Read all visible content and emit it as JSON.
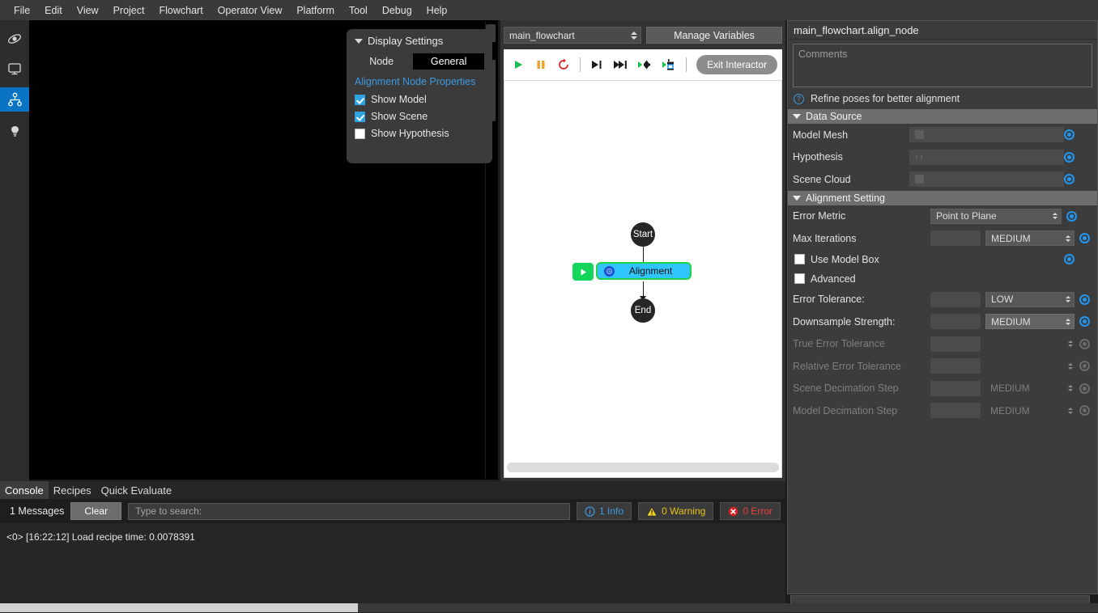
{
  "menubar": {
    "items": [
      "File",
      "Edit",
      "View",
      "Project",
      "Flowchart",
      "Operator View",
      "Platform",
      "Tool",
      "Debug",
      "Help"
    ]
  },
  "rail": {
    "items": [
      {
        "name": "orbit-view-icon",
        "selected": false
      },
      {
        "name": "monitor-icon",
        "selected": false
      },
      {
        "name": "flowchart-hierarchy-icon",
        "selected": true
      },
      {
        "name": "lightbulb-icon",
        "selected": false
      }
    ]
  },
  "display_settings": {
    "title": "Display Settings",
    "node_label": "Node",
    "general_label": "General",
    "properties_link": "Alignment Node Properties",
    "checkboxes": [
      {
        "label": "Show Model",
        "checked": true
      },
      {
        "label": "Show Scene",
        "checked": true
      },
      {
        "label": "Show Hypothesis",
        "checked": false
      }
    ]
  },
  "flowchart": {
    "selector_value": "main_flowchart",
    "manage_variables_label": "Manage Variables",
    "toolbar_icons": [
      "play-icon",
      "pause-icon",
      "reload-icon",
      "step-into-icon",
      "step-over-icon",
      "step-to-node-icon",
      "run-to-interactor-icon"
    ],
    "exit_interactor_label": "Exit Interactor",
    "nodes": [
      {
        "id": "start",
        "label": "Start",
        "type": "circle"
      },
      {
        "id": "alignment",
        "label": "Alignment",
        "type": "box",
        "selected": true
      },
      {
        "id": "end",
        "label": "End",
        "type": "circle"
      }
    ]
  },
  "properties": {
    "title": "main_flowchart.align_node",
    "comments_placeholder": "Comments",
    "hint": "Refine poses for better alignment",
    "sections": [
      {
        "title": "Data Source",
        "rows": [
          {
            "label": "Model Mesh",
            "kind": "field-icon",
            "value": "",
            "enabled": true
          },
          {
            "label": "Hypothesis",
            "kind": "field-icon",
            "value": "‹ ›",
            "enabled": true
          },
          {
            "label": "Scene Cloud",
            "kind": "field-icon",
            "value": "",
            "enabled": true
          }
        ]
      },
      {
        "title": "Alignment Setting",
        "rows": [
          {
            "label": "Error Metric",
            "kind": "select-wide",
            "value": "Point to Plane",
            "enabled": true
          },
          {
            "label": "Max Iterations",
            "kind": "num-select",
            "value": "",
            "select": "MEDIUM",
            "enabled": true
          },
          {
            "label": "Use Model Box",
            "kind": "checkbox",
            "checked": false,
            "enabled": true
          },
          {
            "label": "Advanced",
            "kind": "checkbox",
            "checked": false,
            "enabled": true,
            "no_target": true
          },
          {
            "label": "Error Tolerance:",
            "kind": "num-select",
            "value": "",
            "select": "LOW",
            "enabled": true
          },
          {
            "label": "Downsample Strength:",
            "kind": "num-select",
            "value": "",
            "select": "MEDIUM",
            "enabled": true
          },
          {
            "label": "True Error Tolerance",
            "kind": "num-plain",
            "value": "",
            "select": "",
            "enabled": false
          },
          {
            "label": "Relative Error Tolerance",
            "kind": "num-plain",
            "value": "",
            "select": "",
            "enabled": false
          },
          {
            "label": "Scene Decimation Step",
            "kind": "num-plain",
            "value": "",
            "select": "MEDIUM",
            "enabled": false
          },
          {
            "label": "Model Decimation Step",
            "kind": "num-plain",
            "value": "",
            "select": "MEDIUM",
            "enabled": false
          }
        ]
      }
    ]
  },
  "console": {
    "tabs": [
      {
        "label": "Console",
        "active": true
      },
      {
        "label": "Recipes",
        "active": false
      },
      {
        "label": "Quick Evaluate",
        "active": false
      }
    ],
    "message_count": "1 Messages",
    "clear_label": "Clear",
    "search_placeholder": "Type to search:",
    "filters": [
      {
        "label": "1 Info",
        "icon": "info-icon",
        "color": "#3d9ae0"
      },
      {
        "label": "0 Warning",
        "icon": "warning-icon",
        "color": "#e8c21a"
      },
      {
        "label": "0 Error",
        "icon": "error-icon",
        "color": "#e84040"
      }
    ],
    "log_line": "<0> [16:22:12] Load recipe time: 0.0078391"
  },
  "colors": {
    "accent_blue": "#0a74c4",
    "node_cyan": "#2fc4fa",
    "node_green_border": "#22d24a",
    "link_blue": "#3d9ae0"
  }
}
